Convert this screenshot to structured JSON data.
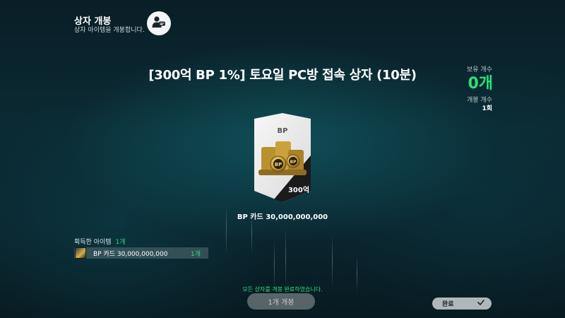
{
  "header": {
    "title": "상자 개봉",
    "subtitle": "상자 아이템을 개봉합니다."
  },
  "box": {
    "title": "[300억 BP 1%] 토요일 PC방 접속 상자 (10분)"
  },
  "stats": {
    "owned_label": "보유 개수",
    "owned_value": "0개",
    "opened_label": "개봉 개수",
    "opened_value": "1회"
  },
  "reward_card": {
    "type_label": "BP",
    "amount_label": "300억",
    "caption": "BP 카드 30,000,000,000",
    "coin_text": "BP"
  },
  "acquired": {
    "label": "획득한 아이템",
    "count": "1개",
    "items": [
      {
        "name": "BP 카드 30,000,000,000",
        "qty": "1개"
      }
    ]
  },
  "footer": {
    "done_message": "모든 상자를 개봉 완료하였습니다.",
    "open_button": "1개 개봉",
    "complete_button": "완료"
  },
  "colors": {
    "accent_green": "#2be07a",
    "background": "#0b2a33"
  },
  "icons": {
    "profile": "user-profile-icon",
    "complete": "checkmark-icon"
  }
}
